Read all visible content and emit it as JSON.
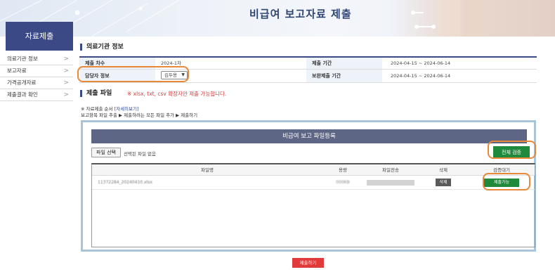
{
  "header": {
    "title": "비급여 보고자료 제출"
  },
  "sidebar": {
    "title": "자료제출",
    "items": [
      {
        "label": "의료기관 정보"
      },
      {
        "label": "보고자료"
      },
      {
        "label": "가격공개자료"
      },
      {
        "label": "제출결과 확인"
      }
    ]
  },
  "institution": {
    "section_title": "의료기관 정보",
    "submit_round_label": "제출 차수",
    "submit_round_value": "2024-1차",
    "submit_period_label": "제출 기간",
    "submit_period_value": "2024-04-15 ~ 2024-06-14",
    "manager_label": "담당자 정보",
    "manager_value": "김두용",
    "supplement_period_label": "보완제출 기간",
    "supplement_period_value": "2024-04-15 ~ 2024-06-14"
  },
  "files": {
    "section_title": "제출 파일",
    "ext_note": "※ xlsx, txt, csv 확장자만 제출 가능합니다.",
    "guide_prefix": "※ 자료제출 순서",
    "guide_link": "[자세히보기]",
    "guide_steps": "보고항목 파일 추출 ▶ 제출하려는 모든 파일 추가 ▶ 제출하기"
  },
  "upload_panel": {
    "title": "비급여 보고 파일등록",
    "choose_file_label": "파일 선택",
    "no_file_label": "선택된 파일 없음",
    "check_all_label": "전체 검증",
    "columns": [
      "파일명",
      "용량",
      "파일전송",
      "삭제",
      "검증대기"
    ],
    "rows": [
      {
        "filename": "11372284_20240410.xlsx",
        "size": "000KB",
        "progress": 1.0,
        "delete_label": "삭제",
        "state_label": "제출가능"
      }
    ]
  },
  "submit_label": "제출하기",
  "colors": {
    "primary": "#3b4a87",
    "highlight": "#e8893a",
    "green": "#1f8a3c",
    "red": "#e03a3a"
  }
}
